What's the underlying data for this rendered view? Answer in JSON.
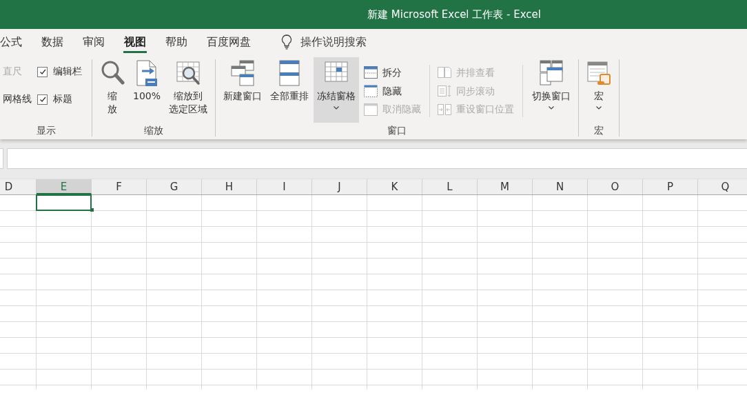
{
  "window": {
    "title": "新建 Microsoft Excel 工作表 - Excel"
  },
  "ribbon": {
    "tabs": [
      {
        "label": "公式",
        "selected": false
      },
      {
        "label": "数据",
        "selected": false
      },
      {
        "label": "审阅",
        "selected": false
      },
      {
        "label": "视图",
        "selected": true
      },
      {
        "label": "帮助",
        "selected": false
      },
      {
        "label": "百度网盘",
        "selected": false
      }
    ],
    "search": {
      "label": "操作说明搜索"
    },
    "groups": [
      {
        "label": "显示",
        "sections": [
          {
            "kind": "options",
            "items": [
              {
                "kind": "label",
                "label": "直尺",
                "disabled": true
              },
              {
                "kind": "label",
                "label": "网格线",
                "disabled": false
              }
            ]
          },
          {
            "kind": "options",
            "items": [
              {
                "kind": "checkbox",
                "label": "编辑栏",
                "checked": true
              },
              {
                "kind": "checkbox",
                "label": "标题",
                "checked": true
              }
            ]
          }
        ]
      },
      {
        "label": "缩放",
        "sections": [
          {
            "kind": "large",
            "buttons": [
              {
                "lines": [
                  "缩",
                  "放"
                ],
                "kind": "magnifier",
                "dropdown": false,
                "highlighted": false
              },
              {
                "lines": [
                  "100%"
                ],
                "kind": "page_arrow",
                "dropdown": false,
                "highlighted": false
              },
              {
                "lines": [
                  "缩放到",
                  "选定区域"
                ],
                "kind": "grid_magnifier",
                "dropdown": false,
                "highlighted": false
              }
            ]
          }
        ]
      },
      {
        "label": "窗口",
        "sections": [
          {
            "kind": "large",
            "buttons": [
              {
                "lines": [
                  "新建窗口"
                ],
                "kind": "new_window",
                "dropdown": false,
                "highlighted": false
              },
              {
                "lines": [
                  "全部重排"
                ],
                "kind": "arrange",
                "dropdown": false,
                "highlighted": false
              },
              {
                "lines": [
                  "冻结窗格"
                ],
                "kind": "freeze",
                "dropdown": true,
                "highlighted": true
              }
            ]
          },
          {
            "kind": "small",
            "divider": true,
            "buttons": [
              {
                "label": "拆分",
                "kind": "split",
                "disabled": false
              },
              {
                "label": "隐藏",
                "kind": "hide",
                "disabled": false
              },
              {
                "label": "取消隐藏",
                "kind": "unhide",
                "disabled": true
              }
            ]
          },
          {
            "kind": "small",
            "divider": true,
            "buttons": [
              {
                "label": "并排查看",
                "kind": "side_by_side",
                "disabled": true
              },
              {
                "label": "同步滚动",
                "kind": "sync",
                "disabled": true
              },
              {
                "label": "重设窗口位置",
                "kind": "reset",
                "disabled": true
              }
            ]
          },
          {
            "kind": "large",
            "buttons": [
              {
                "lines": [
                  "切换窗口"
                ],
                "kind": "switch",
                "dropdown": true,
                "highlighted": false
              }
            ]
          }
        ]
      },
      {
        "label": "宏",
        "sections": [
          {
            "kind": "large",
            "buttons": [
              {
                "lines": [
                  "宏"
                ],
                "kind": "macro",
                "dropdown": true,
                "highlighted": false
              }
            ]
          }
        ]
      }
    ]
  },
  "sheet": {
    "columns": [
      {
        "label": "D",
        "selected": false
      },
      {
        "label": "E",
        "selected": true
      },
      {
        "label": "F",
        "selected": false
      },
      {
        "label": "G",
        "selected": false
      },
      {
        "label": "H",
        "selected": false
      },
      {
        "label": "I",
        "selected": false
      },
      {
        "label": "J",
        "selected": false
      },
      {
        "label": "K",
        "selected": false
      },
      {
        "label": "L",
        "selected": false
      },
      {
        "label": "M",
        "selected": false
      },
      {
        "label": "N",
        "selected": false
      },
      {
        "label": "O",
        "selected": false
      },
      {
        "label": "P",
        "selected": false
      },
      {
        "label": "Q",
        "selected": false
      }
    ]
  }
}
